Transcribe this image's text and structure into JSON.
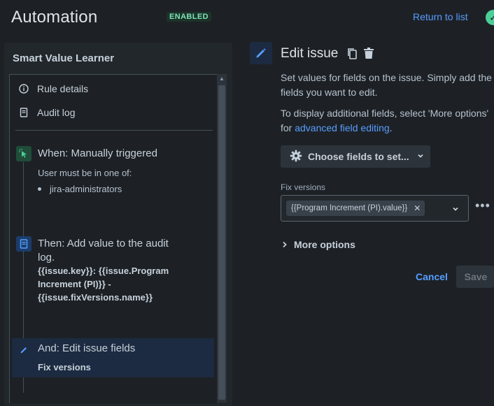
{
  "header": {
    "title": "Automation",
    "status_badge": "ENABLED",
    "return_link": "Return to list",
    "status_icon": "check-circle-icon"
  },
  "sidebar": {
    "title": "Smart Value Learner",
    "nav": [
      {
        "label": "Rule details",
        "icon": "info-icon"
      },
      {
        "label": "Audit log",
        "icon": "document-icon"
      }
    ],
    "steps": {
      "trigger": {
        "title": "When: Manually triggered",
        "subtitle": "User must be in one of:",
        "bullet": "jira-administrators",
        "icon": "cursor-click-icon"
      },
      "action1": {
        "title": "Then: Add value to the audit log.",
        "detail": "{{issue.key}}: {{issue.Program Increment (PI)}} - {{issue.fixVersions.name}}",
        "icon": "document-icon"
      },
      "action2": {
        "title": "And: Edit issue fields",
        "subtitle": "Fix versions",
        "icon": "pencil-icon"
      }
    }
  },
  "editor": {
    "title": "Edit issue",
    "description1": "Set values for fields on the issue. Simply add the fields you want to edit.",
    "description2_prefix": "To display additional fields, select 'More options' for ",
    "description2_link": "advanced field editing",
    "description2_suffix": ".",
    "choose_button": "Choose fields to set...",
    "field": {
      "label": "Fix versions",
      "tag": "{{Program Increment (PI).value}}"
    },
    "more_options": "More options",
    "cancel": "Cancel",
    "save": "Save"
  },
  "colors": {
    "background": "#1d2125",
    "panel": "#22272b",
    "accent_link": "#579dff",
    "selected_step": "#1c2b41",
    "enabled_badge": "#7ee2b8"
  }
}
